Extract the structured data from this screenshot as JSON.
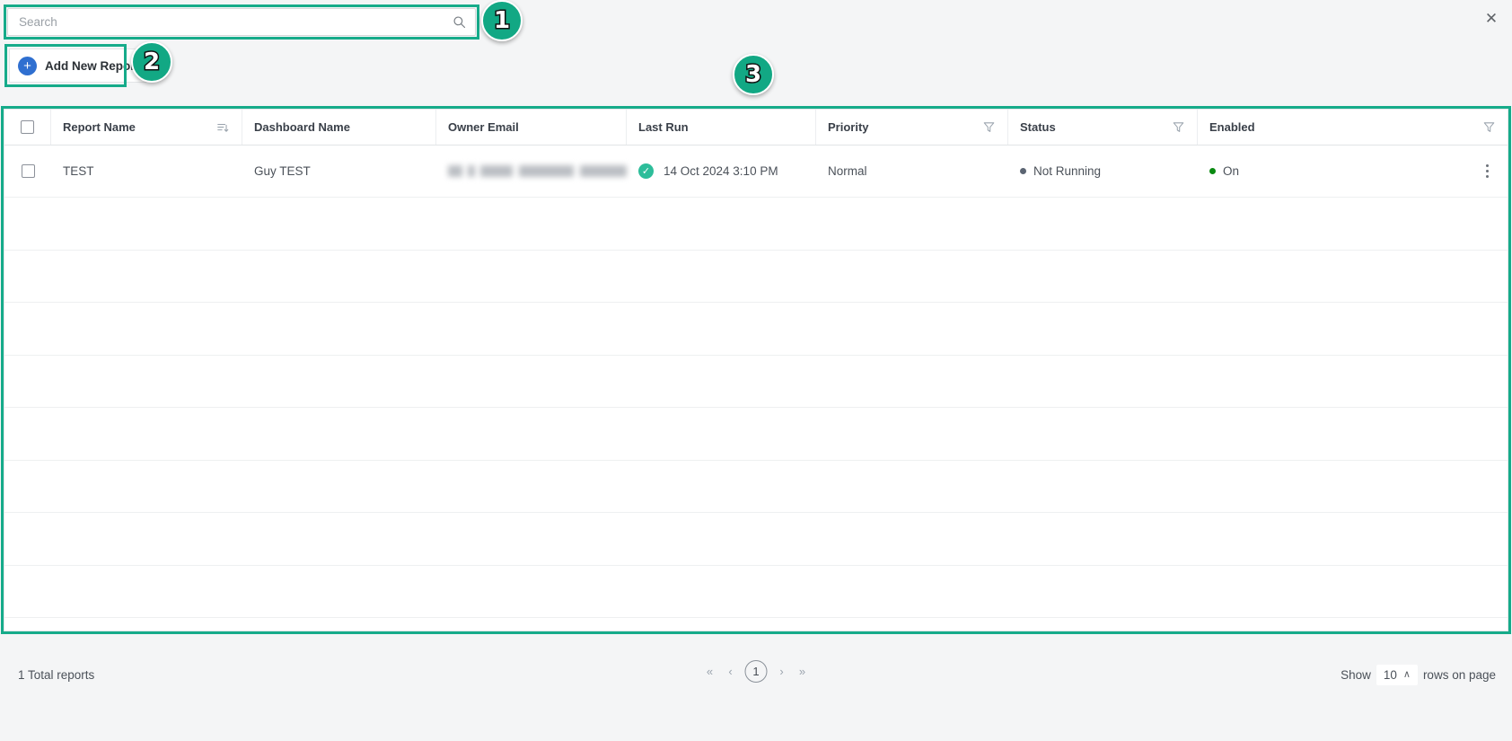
{
  "window": {
    "close_label": "✕"
  },
  "search": {
    "placeholder": "Search",
    "value": "",
    "icon": "search-icon"
  },
  "toolbar": {
    "add_new_reports_label": "Add New Reports",
    "add_icon": "plus-icon"
  },
  "table": {
    "columns": [
      {
        "key": "select",
        "label": "",
        "tool": ""
      },
      {
        "key": "report",
        "label": "Report Name",
        "tool": "sort-icon"
      },
      {
        "key": "dashboard",
        "label": "Dashboard Name",
        "tool": ""
      },
      {
        "key": "owner",
        "label": "Owner Email",
        "tool": ""
      },
      {
        "key": "lastrun",
        "label": "Last Run",
        "tool": ""
      },
      {
        "key": "priority",
        "label": "Priority",
        "tool": "filter-icon"
      },
      {
        "key": "status",
        "label": "Status",
        "tool": "filter-icon"
      },
      {
        "key": "enabled",
        "label": "Enabled",
        "tool": "filter-icon"
      }
    ],
    "rows": [
      {
        "report_name": "TEST",
        "dashboard_name": "Guy TEST",
        "owner_email": "",
        "owner_email_redacted": true,
        "last_run": "14 Oct 2024 3:10 PM",
        "last_run_status_icon": "check-circle-icon",
        "priority": "Normal",
        "status": "Not Running",
        "status_dot_color": "#5b6472",
        "enabled": "On",
        "enabled_dot_color": "#0a8a11",
        "menu_icon": "kebab-menu-icon"
      }
    ],
    "empty_row_count": 9
  },
  "footer": {
    "total_reports": "1 Total reports",
    "pagination": {
      "first_label": "«",
      "prev_label": "‹",
      "current_page": "1",
      "next_label": "›",
      "last_label": "»"
    },
    "rows_per_page": {
      "prefix": "Show",
      "value": "10",
      "caret": "∧",
      "suffix": "rows on page"
    }
  },
  "annotations": {
    "accent_color": "#12a884",
    "badges": [
      {
        "label": "1",
        "target": "search-box"
      },
      {
        "label": "2",
        "target": "add-new-reports-button"
      },
      {
        "label": "3",
        "target": "reports-table"
      }
    ]
  }
}
